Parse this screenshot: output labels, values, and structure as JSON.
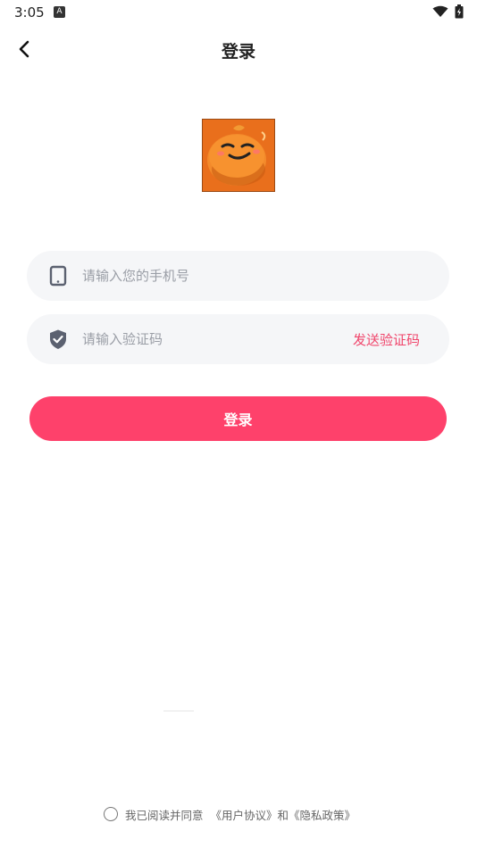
{
  "status_bar": {
    "time": "3:05",
    "notification_icon": "a-letter-icon",
    "wifi_icon": "wifi-icon",
    "battery_icon": "battery-icon"
  },
  "header": {
    "back_icon": "chevron-left-icon",
    "title": "登录"
  },
  "logo": {
    "icon": "orange-mascot-logo",
    "colors": {
      "background": "#e96f1c",
      "orange": "#f58a2e"
    }
  },
  "form": {
    "phone": {
      "placeholder": "请输入您的手机号",
      "value": "",
      "icon": "phone-icon"
    },
    "code": {
      "placeholder": "请输入验证码",
      "value": "",
      "icon": "shield-check-icon"
    },
    "send_code_label": "发送验证码",
    "login_label": "登录"
  },
  "agreement": {
    "prefix": "我已阅读并同意",
    "user_agreement": "《用户协议》",
    "conjunction": "和",
    "privacy_policy": "《隐私政策》"
  },
  "colors": {
    "accent": "#fe416b",
    "input_bg": "#f5f6f8",
    "placeholder": "#9a9ea6"
  }
}
